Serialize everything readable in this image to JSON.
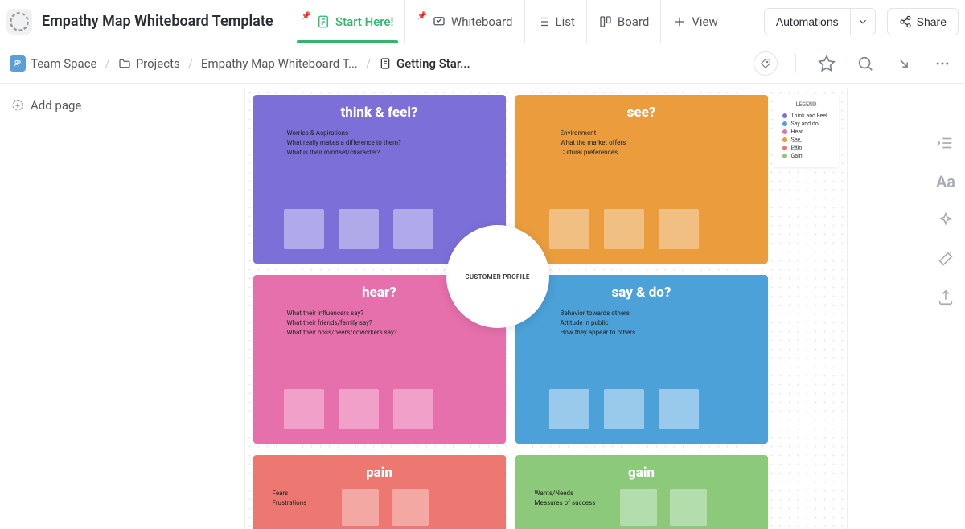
{
  "header": {
    "title": "Empathy Map Whiteboard Template",
    "tabs": {
      "start": "Start Here!",
      "whiteboard": "Whiteboard",
      "list": "List",
      "board": "Board",
      "view": "View"
    },
    "automations": "Automations",
    "share": "Share"
  },
  "breadcrumb": {
    "team": "Team Space",
    "projects": "Projects",
    "template": "Empathy Map Whiteboard T...",
    "current": "Getting Star..."
  },
  "sidebar": {
    "add_page": "Add page"
  },
  "canvas": {
    "center": "CUSTOMER PROFILE",
    "quadrants": {
      "think": {
        "title": "think & feel?",
        "prompts": [
          "Worries & Aspirations",
          "What really makes a difference to them?",
          "What is their mindset/character?"
        ]
      },
      "see": {
        "title": "see?",
        "prompts": [
          "Environment",
          "What the market offers",
          "Cultural preferences"
        ]
      },
      "hear": {
        "title": "hear?",
        "prompts": [
          "What their influencers say?",
          "What their friends/family say?",
          "What their boss/peers/coworkers say?"
        ]
      },
      "saydo": {
        "title": "say & do?",
        "prompts": [
          "Behavior towards others",
          "Attitude in public",
          "How they appear to others"
        ]
      },
      "pain": {
        "title": "pain",
        "prompts": [
          "Fears",
          "Frustrations"
        ]
      },
      "gain": {
        "title": "gain",
        "prompts": [
          "Wants/Needs",
          "Measures of success"
        ]
      }
    },
    "legend": {
      "title": "LEGEND",
      "items": [
        {
          "label": "Think and Feel",
          "color": "#7c6fd8"
        },
        {
          "label": "Say and do",
          "color": "#4ba1d8"
        },
        {
          "label": "Hear",
          "color": "#e670ac"
        },
        {
          "label": "See",
          "color": "#eb9d3e"
        },
        {
          "label": "Pain",
          "color": "#ed7771"
        },
        {
          "label": "Gain",
          "color": "#8cc97a"
        }
      ]
    }
  }
}
